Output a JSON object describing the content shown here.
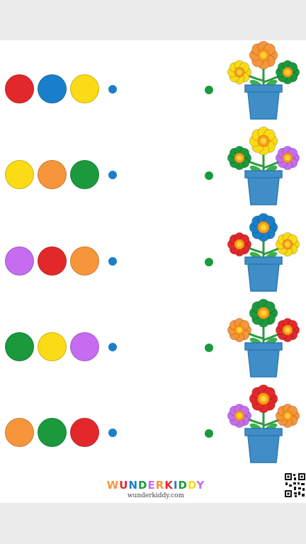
{
  "colors": {
    "red": "#e3282b",
    "blue": "#1a7fcb",
    "yellow": "#fbdb15",
    "orange": "#f7953a",
    "green": "#1a9a3d",
    "purple": "#c56cf0",
    "left_dot": "#1a7fcb",
    "right_dot": "#1a9a3d",
    "pot": "#3f8ec8",
    "pot_rim": "#2f78b0",
    "stem": "#2e9a3e",
    "leaf": "#3cb04b"
  },
  "rows": [
    {
      "circles": [
        "red",
        "blue",
        "yellow"
      ],
      "flowers": {
        "top": "orange",
        "left": "yellow",
        "right": "green"
      }
    },
    {
      "circles": [
        "yellow",
        "orange",
        "green"
      ],
      "flowers": {
        "top": "yellow",
        "left": "green",
        "right": "purple"
      }
    },
    {
      "circles": [
        "purple",
        "red",
        "orange"
      ],
      "flowers": {
        "top": "blue",
        "left": "red",
        "right": "yellow"
      }
    },
    {
      "circles": [
        "green",
        "yellow",
        "purple"
      ],
      "flowers": {
        "top": "green",
        "left": "orange",
        "right": "red"
      }
    },
    {
      "circles": [
        "orange",
        "green",
        "red"
      ],
      "flowers": {
        "top": "red",
        "left": "purple",
        "right": "orange"
      }
    }
  ],
  "brand": {
    "name": "WUNDERKIDDY",
    "letter_colors": [
      "#f7953a",
      "#e3282b",
      "#1a7fcb",
      "#1a9a3d",
      "#c56cf0",
      "#f7953a",
      "#e3282b",
      "#1a7fcb",
      "#1a9a3d",
      "#fbdb15",
      "#c56cf0"
    ],
    "url": "wunderkiddy.com"
  },
  "icons": {
    "qr": "qr-code-icon"
  }
}
